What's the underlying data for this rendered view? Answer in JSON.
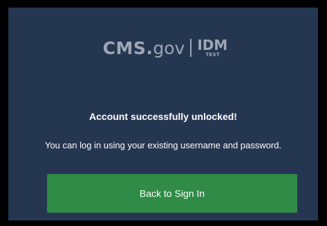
{
  "logo": {
    "cms": "CMS.",
    "gov": "gov",
    "idm": "IDM",
    "env": "TEST"
  },
  "notice": {
    "title": "Account successfully unlocked!",
    "message": "You can log in using your existing username and password."
  },
  "actions": {
    "back_to_sign_in": "Back to Sign In"
  },
  "colors": {
    "panel_bg": "#253650",
    "logo_gray": "#9ea7b3",
    "button_green": "#2f8b45",
    "text_white": "#ffffff"
  }
}
